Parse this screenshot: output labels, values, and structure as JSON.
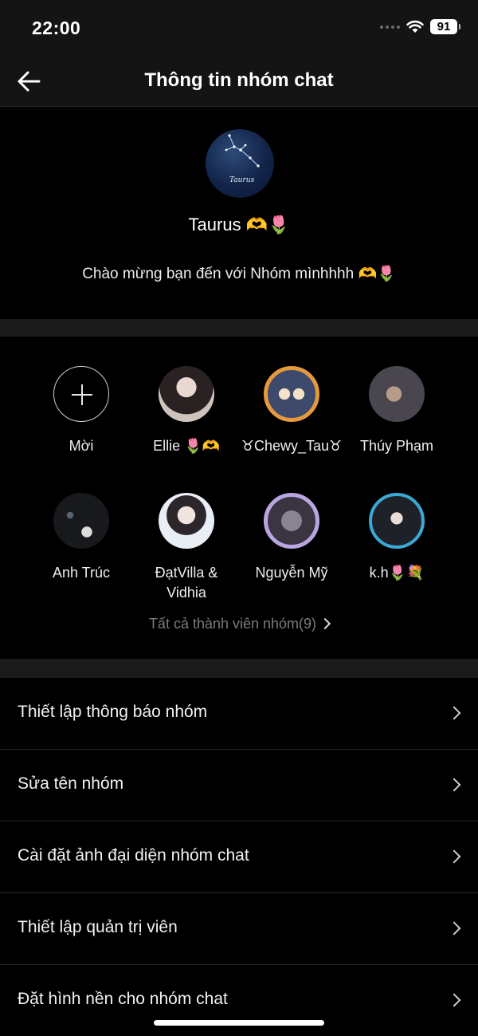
{
  "status_bar": {
    "time": "22:00",
    "battery": "91"
  },
  "nav": {
    "title": "Thông tin nhóm chat"
  },
  "group": {
    "name": "Taurus 🫶🌷",
    "description": "Chào mừng bạn đến với Nhóm mìnhhhh 🫶🌷",
    "avatar_text": "Taurus"
  },
  "members": {
    "items": [
      {
        "label": "Mời"
      },
      {
        "label": "Ellie 🌷🫶"
      },
      {
        "label": "♉Chewy_Tau♉"
      },
      {
        "label": "Thúy Phạm"
      },
      {
        "label": "Anh Trúc"
      },
      {
        "label": "ĐạtVilla & Vidhia"
      },
      {
        "label": "Nguyễn Mỹ"
      },
      {
        "label": "k.h🌷💐"
      }
    ],
    "all_members_label": "Tất cả thành viên nhóm(9)"
  },
  "settings": [
    {
      "label": "Thiết lập thông báo nhóm"
    },
    {
      "label": "Sửa tên nhóm"
    },
    {
      "label": "Cài đặt ảnh đại diện nhóm chat"
    },
    {
      "label": "Thiết lập quản trị viên"
    },
    {
      "label": "Đặt hình nền cho nhóm chat"
    }
  ]
}
